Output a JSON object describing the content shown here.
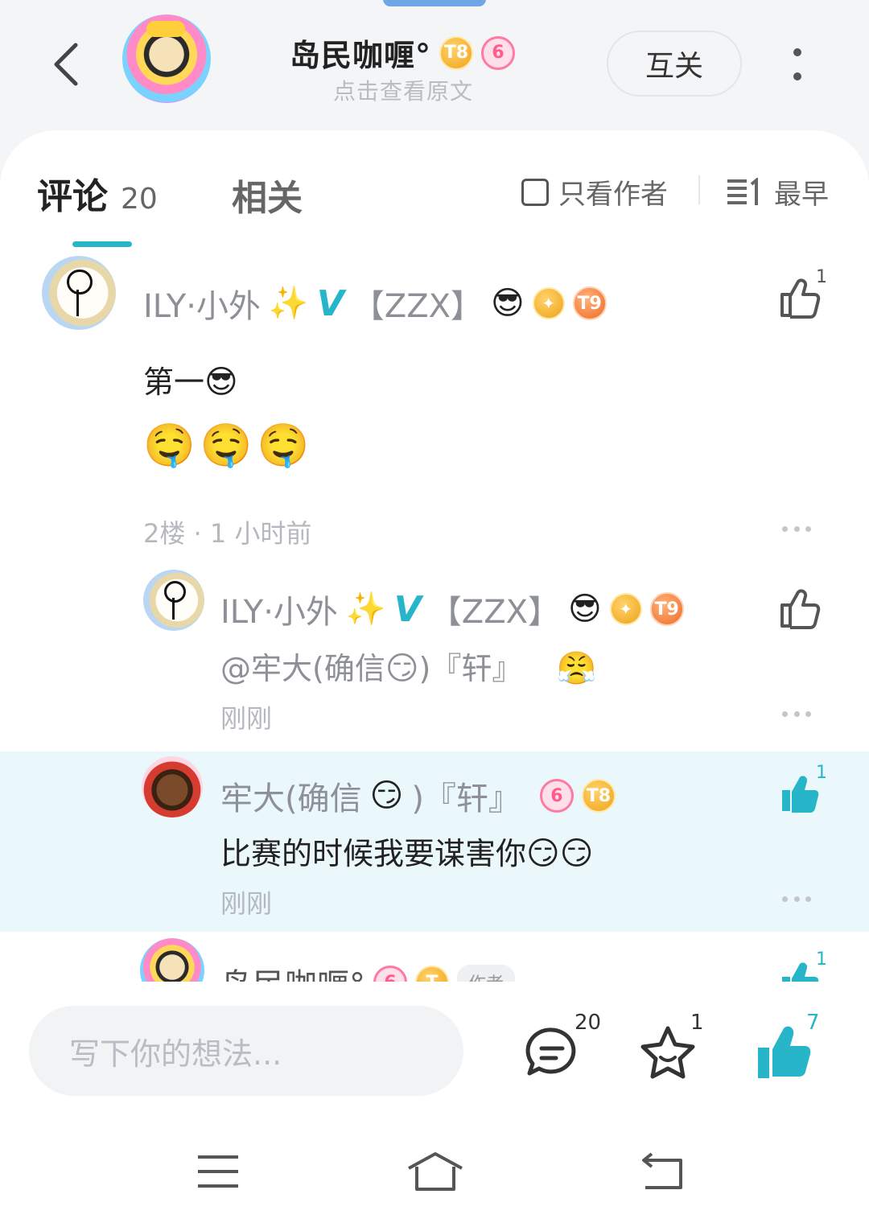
{
  "header": {
    "name": "岛民咖喱°",
    "subtitle": "点击查看原文",
    "mutual_label": "互关",
    "badges": [
      "T8",
      "6"
    ]
  },
  "tabs": {
    "comments_label": "评论",
    "comments_count": "20",
    "related_label": "相关",
    "author_only_label": "只看作者",
    "sort_label": "最早"
  },
  "comments": [
    {
      "name": "ILY·小外",
      "sparkle": "✨",
      "verified": "V",
      "tag": "【ZZX】",
      "emoji": "😎",
      "badge": "T9",
      "text": "第一",
      "text_emoji": "😎",
      "stickers": [
        "🤤",
        "🤤",
        "🤤"
      ],
      "meta": "2楼 · 1 小时前",
      "likes": "1"
    },
    {
      "name": "ILY·小外",
      "sparkle": "✨",
      "verified": "V",
      "tag": "【ZZX】",
      "emoji": "😎",
      "badge": "T9",
      "text_prefix": "@牢大(确信",
      "text_mid_emoji": "😏",
      "text_suffix": ")『轩』",
      "text_emoji": "😤",
      "meta": "刚刚"
    },
    {
      "name": "牢大(确信",
      "name_emoji": "😏",
      "name_suffix": ")『轩』",
      "badges": [
        "6",
        "T8"
      ],
      "text": "比赛的时候我要谋害你",
      "text_emojis": "😏😏",
      "meta": "刚刚",
      "likes": "1"
    },
    {
      "name": "岛民咖喱°",
      "badges": [
        "6",
        "T"
      ],
      "author_tag": "作者",
      "likes": "1"
    }
  ],
  "bottom": {
    "input_placeholder": "写下你的想法...",
    "comment_count": "20",
    "favorite_count": "1",
    "like_count": "7"
  },
  "colors": {
    "accent": "#27b6c9",
    "highlight_bg": "#eaf7fb",
    "muted_text": "#8d9096"
  }
}
